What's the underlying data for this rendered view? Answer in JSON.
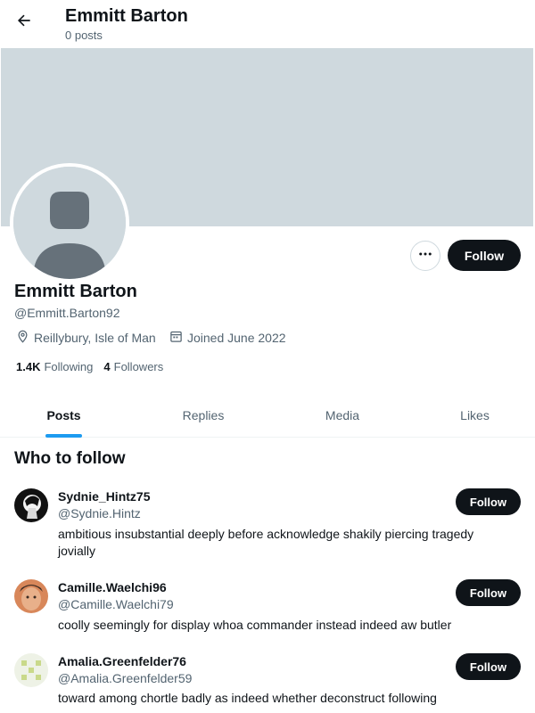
{
  "header": {
    "back_icon": "arrow-left-icon",
    "title": "Emmitt Barton",
    "subtitle": "0 posts"
  },
  "profile": {
    "name": "Emmitt Barton",
    "handle": "@Emmitt.Barton92",
    "location": "Reillybury, Isle of Man",
    "joined": "Joined June 2022",
    "following_count": "1.4K",
    "following_label": "Following",
    "followers_count": "4",
    "followers_label": "Followers",
    "follow_label": "Follow",
    "more_icon": "more-horizontal-icon",
    "banner_color": "#cfd9de"
  },
  "tabs": [
    {
      "label": "Posts",
      "active": true
    },
    {
      "label": "Replies",
      "active": false
    },
    {
      "label": "Media",
      "active": false
    },
    {
      "label": "Likes",
      "active": false
    }
  ],
  "who_to_follow": {
    "title": "Who to follow",
    "users": [
      {
        "name": "Sydnie_Hintz75",
        "handle": "@Sydnie.Hintz",
        "bio": "ambitious insubstantial deeply before acknowledge shakily piercing tragedy jovially",
        "follow_label": "Follow"
      },
      {
        "name": "Camille.Waelchi96",
        "handle": "@Camille.Waelchi79",
        "bio": "coolly seemingly for display whoa commander instead indeed aw butler",
        "follow_label": "Follow"
      },
      {
        "name": "Amalia.Greenfelder76",
        "handle": "@Amalia.Greenfelder59",
        "bio": "toward among chortle badly as indeed whether deconstruct following",
        "follow_label": "Follow"
      }
    ]
  },
  "colors": {
    "accent": "#1d9bf0",
    "text": "#0f1419",
    "secondary": "#536471",
    "button": "#0f1419"
  }
}
